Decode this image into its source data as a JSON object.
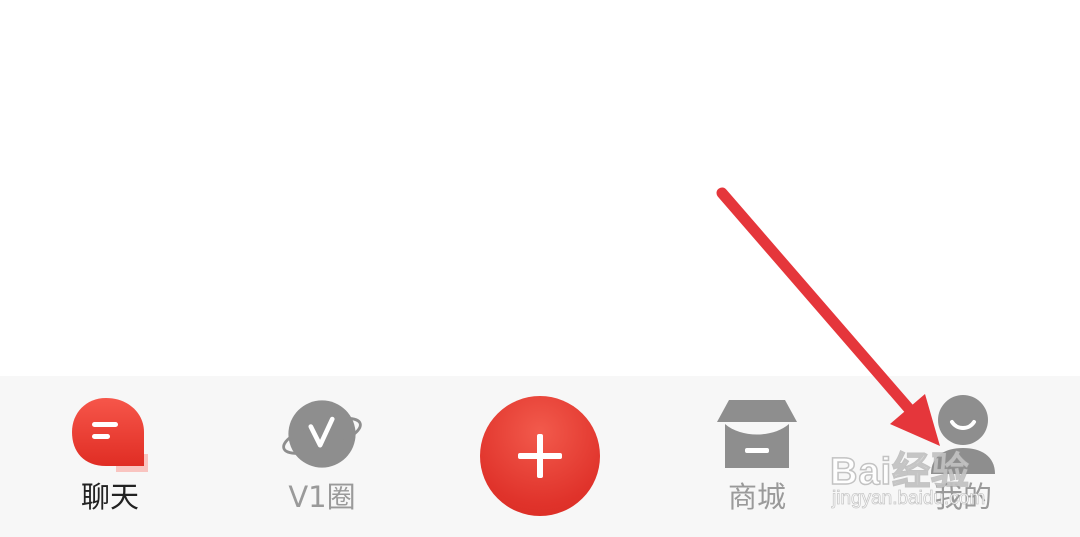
{
  "tabbar": {
    "tabs": [
      {
        "label": "聊天",
        "icon": "chat-bubble-icon",
        "active": true
      },
      {
        "label": "V1圈",
        "icon": "v1-orbit-icon",
        "active": false
      },
      {
        "label": "商城",
        "icon": "store-icon",
        "active": false
      },
      {
        "label": "我的",
        "icon": "profile-icon",
        "active": false
      }
    ],
    "add_button": {
      "icon": "plus-icon"
    },
    "colors": {
      "accent": "#e0332b",
      "inactive": "#9a9a9a",
      "active_label": "#222222"
    }
  },
  "annotation": {
    "icon": "red-arrow-icon",
    "color": "#e5363b"
  },
  "watermark": {
    "logo": "Bai经验",
    "url": "jingyan.baidu.com"
  }
}
